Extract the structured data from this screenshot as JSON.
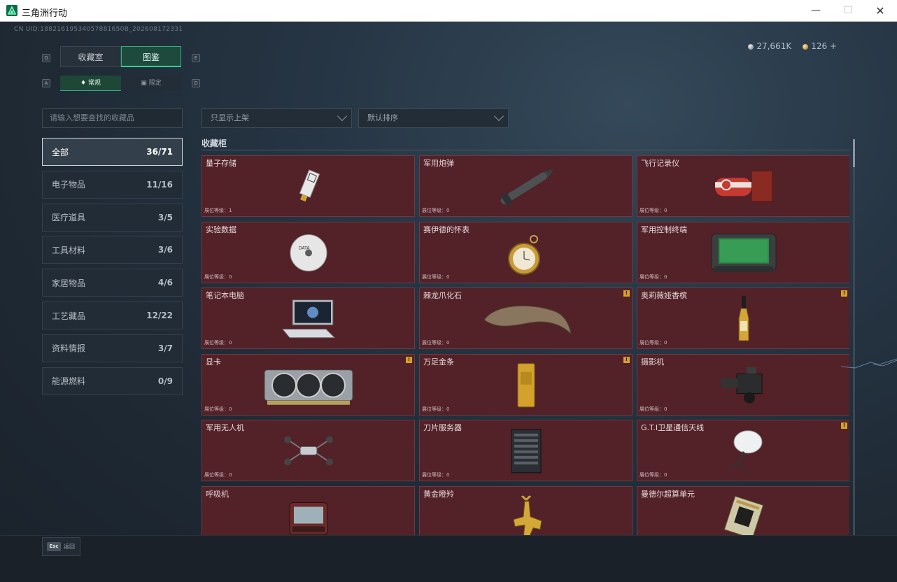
{
  "window": {
    "title": "三角洲行动"
  },
  "header": {
    "uid": "CN UID:18821619534057881650B_202608172331",
    "currency": [
      {
        "icon": "silver-coin-icon",
        "value": "27,661K"
      },
      {
        "icon": "gold-coin-icon",
        "value": "126",
        "add": "+"
      }
    ]
  },
  "tabs": [
    {
      "label": "收藏室"
    },
    {
      "label": "图鉴"
    }
  ],
  "tab_keys": {
    "left": "Q",
    "right": "E"
  },
  "subtabs": [
    {
      "label": "常规"
    },
    {
      "label": "限定"
    }
  ],
  "subtab_keys": {
    "left": "A",
    "right": "D"
  },
  "search": {
    "placeholder": "请输入想要查找的收藏品"
  },
  "filters": [
    {
      "label": "只显示上架"
    },
    {
      "label": "默认排序"
    }
  ],
  "categories": [
    {
      "label": "全部",
      "count": "36/71"
    },
    {
      "label": "电子物品",
      "count": "11/16"
    },
    {
      "label": "医疗道具",
      "count": "3/5"
    },
    {
      "label": "工具材料",
      "count": "3/6"
    },
    {
      "label": "家居物品",
      "count": "4/6"
    },
    {
      "label": "工艺藏品",
      "count": "12/22"
    },
    {
      "label": "资料情报",
      "count": "3/7"
    },
    {
      "label": "能源燃料",
      "count": "0/9"
    }
  ],
  "section": {
    "title": "收藏柜"
  },
  "items": [
    {
      "name": "量子存储",
      "level": "展位等级：1",
      "flag": ""
    },
    {
      "name": "军用炮弹",
      "level": "展位等级：0",
      "flag": ""
    },
    {
      "name": "飞行记录仪",
      "level": "展位等级：0",
      "flag": ""
    },
    {
      "name": "实验数据",
      "level": "展位等级：0",
      "flag": ""
    },
    {
      "name": "赛伊德的怀表",
      "level": "展位等级：0",
      "flag": ""
    },
    {
      "name": "军用控制终端",
      "level": "展位等级：0",
      "flag": ""
    },
    {
      "name": "笔记本电脑",
      "level": "展位等级：0",
      "flag": ""
    },
    {
      "name": "棘龙爪化石",
      "level": "展位等级：0",
      "flag": "!"
    },
    {
      "name": "奥莉薇娅香槟",
      "level": "展位等级：0",
      "flag": "!"
    },
    {
      "name": "显卡",
      "level": "展位等级：0",
      "flag": "!"
    },
    {
      "name": "万足金条",
      "level": "展位等级：0",
      "flag": "!"
    },
    {
      "name": "摄影机",
      "level": "展位等级：0",
      "flag": ""
    },
    {
      "name": "军用无人机",
      "level": "展位等级：0",
      "flag": ""
    },
    {
      "name": "刀片服务器",
      "level": "展位等级：0",
      "flag": ""
    },
    {
      "name": "G.T.I卫星通信天线",
      "level": "展位等级：0",
      "flag": "!"
    },
    {
      "name": "呼吸机",
      "level": "",
      "flag": ""
    },
    {
      "name": "黄金瞪羚",
      "level": "",
      "flag": ""
    },
    {
      "name": "曼德尔超算单元",
      "level": "",
      "flag": ""
    }
  ],
  "footer": {
    "esc_key": "Esc",
    "back_label": "返回"
  }
}
